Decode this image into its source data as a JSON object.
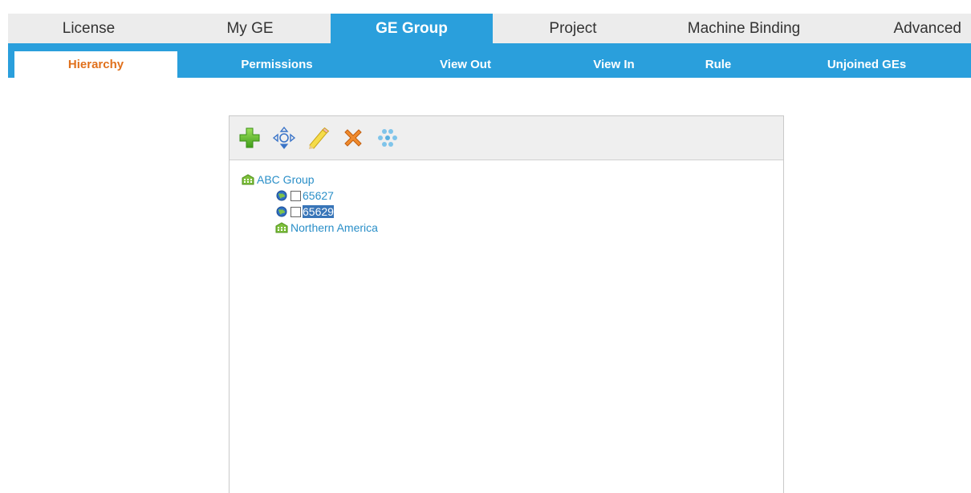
{
  "top_tabs": [
    {
      "label": "License"
    },
    {
      "label": "My GE"
    },
    {
      "label": "GE Group",
      "active": true
    },
    {
      "label": "Project"
    },
    {
      "label": "Machine Binding"
    },
    {
      "label": "Advanced"
    }
  ],
  "sub_tabs": [
    {
      "label": "Hierarchy",
      "active": true
    },
    {
      "label": "Permissions"
    },
    {
      "label": "View Out"
    },
    {
      "label": "View In"
    },
    {
      "label": "Rule"
    },
    {
      "label": "Unjoined GEs"
    }
  ],
  "toolbar": {
    "icons": [
      "add-icon",
      "move-icon",
      "edit-pencil-icon",
      "delete-icon",
      "group-dots-icon"
    ]
  },
  "tree": {
    "root": {
      "label": "ABC Group",
      "icon": "building-icon"
    },
    "children": [
      {
        "label": "65627",
        "icon": "globe-icon",
        "checked": false,
        "selected": false
      },
      {
        "label": "65629",
        "icon": "globe-icon",
        "checked": false,
        "selected": true
      },
      {
        "label": "Northern America",
        "icon": "building-icon"
      }
    ]
  },
  "colors": {
    "accent": "#2a9fdc",
    "active_subtab_text": "#e0701c",
    "tab_bar_bg": "#ececec",
    "link_text": "#2a8fc8",
    "selection": "#3875b8"
  }
}
